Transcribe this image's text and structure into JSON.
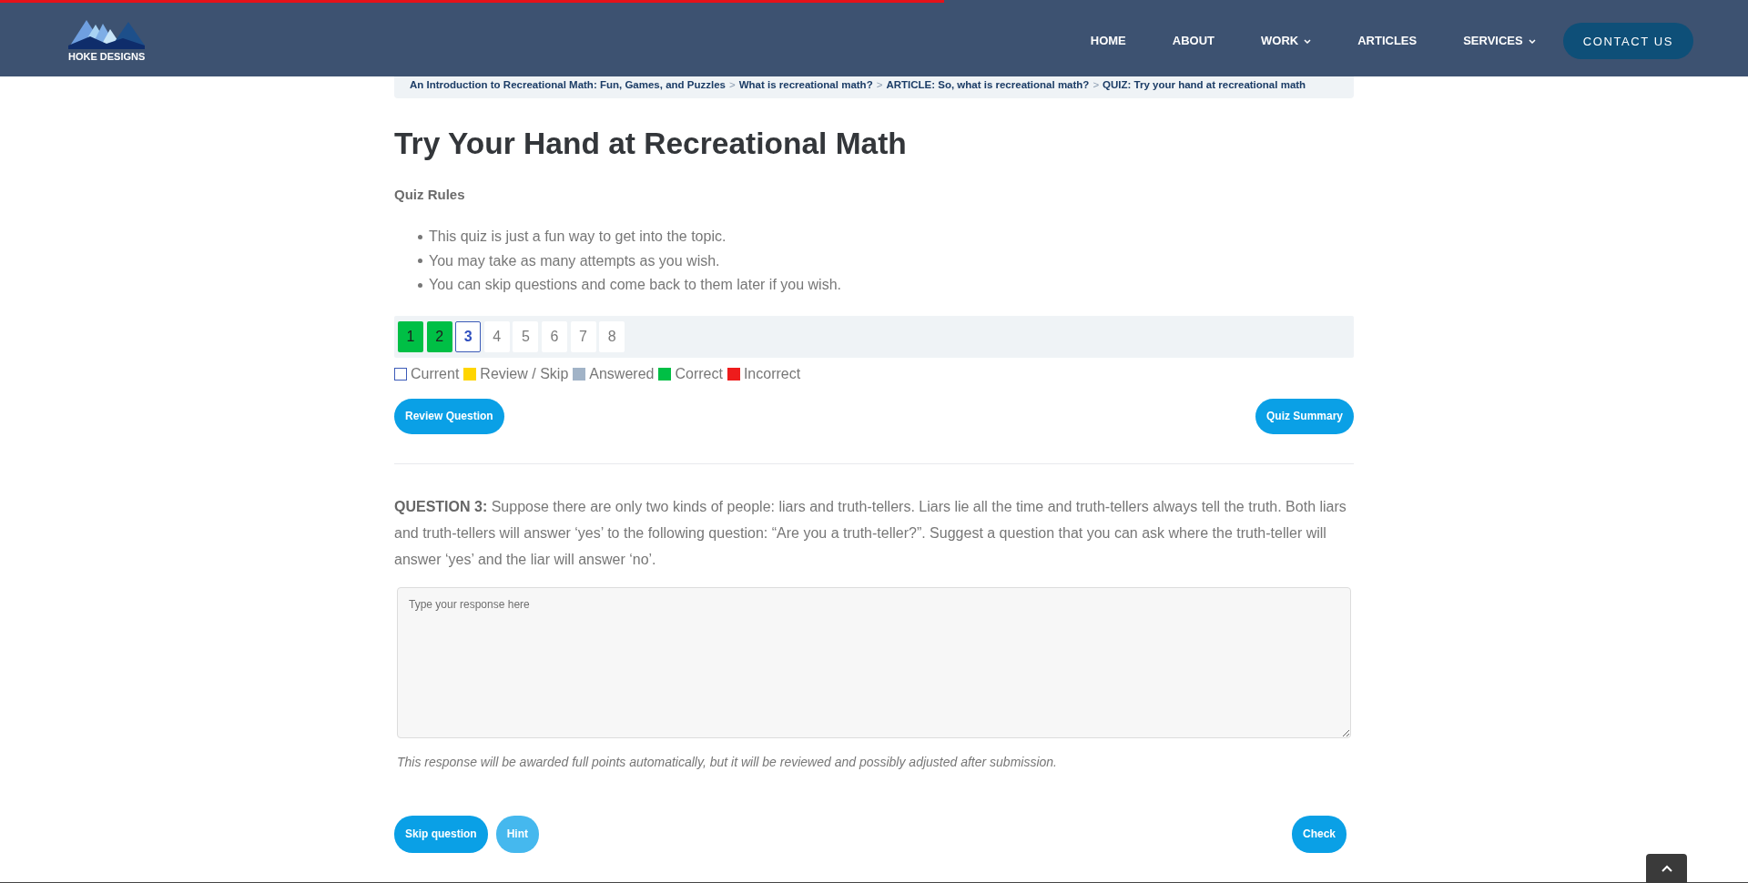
{
  "reading_progress": {
    "level": 0.54
  },
  "header": {
    "logo_text": "HOKE DESIGNS",
    "nav": [
      {
        "label": "HOME",
        "dropdown": false
      },
      {
        "label": "ABOUT",
        "dropdown": false
      },
      {
        "label": "WORK",
        "dropdown": true
      },
      {
        "label": "ARTICLES",
        "dropdown": false
      },
      {
        "label": "SERVICES",
        "dropdown": true
      }
    ],
    "contact_button": "CONTACT US"
  },
  "breadcrumb": [
    {
      "kind": "link",
      "text": "An Introduction to Recreational Math: Fun, Games, and Puzzles"
    },
    {
      "kind": "separator",
      "text": ">"
    },
    {
      "kind": "link",
      "text": "What is recreational math?"
    },
    {
      "kind": "separator",
      "text": ">"
    },
    {
      "kind": "link",
      "text": "ARTICLE: So, what is recreational math?"
    },
    {
      "kind": "separator",
      "text": ">"
    },
    {
      "kind": "link",
      "text": "QUIZ: Try your hand at recreational math"
    }
  ],
  "title": "Try Your Hand at Recreational Math",
  "rules": {
    "heading": "Quiz Rules",
    "items": [
      "This quiz is just a fun way to get into the topic.",
      "You may take as many attempts as you wish.",
      "You can skip questions and come back to them later if you wish."
    ]
  },
  "pagination": [
    {
      "label": "1",
      "correct": true,
      "selected": false
    },
    {
      "label": "2",
      "correct": true,
      "selected": false
    },
    {
      "label": "3",
      "correct": false,
      "selected": true
    },
    {
      "label": "4",
      "correct": false,
      "selected": false
    },
    {
      "label": "5",
      "correct": false,
      "selected": false
    },
    {
      "label": "6",
      "correct": false,
      "selected": false
    },
    {
      "label": "7",
      "correct": false,
      "selected": false
    },
    {
      "label": "8",
      "correct": false,
      "selected": false
    }
  ],
  "legend": [
    {
      "label": "Current",
      "kind": "outline",
      "color": "#3c5bb8"
    },
    {
      "label": "Review / Skip",
      "kind": "fill",
      "color": "#ffd500"
    },
    {
      "label": "Answered",
      "kind": "fill",
      "color": "#a1b3c7"
    },
    {
      "label": "Correct",
      "kind": "fill",
      "color": "#00bf45"
    },
    {
      "label": "Incorrect",
      "kind": "fill",
      "color": "#ee1c1c"
    }
  ],
  "review_button": {
    "label": "Review Question"
  },
  "summary_button": {
    "label": "Quiz Summary"
  },
  "question": {
    "text": "**QUESTION 3:** Suppose there are only two kinds of people: liars and truth-tellers. Liars lie all the time and truth-tellers always tell the truth. Both liars and truth-tellers will answer ‘yes’ to the following question: “Are you a truth-teller?”. Suggest a question that you can ask where the truth-teller will answer ‘yes’ and the liar will answer ‘no’.",
    "answer": {
      "placeholder": "Type your response here"
    },
    "note": "This response will be awarded full points automatically, but it will be reviewed and possibly adjusted after submission."
  },
  "question_actions": [
    {
      "label": "Skip question",
      "disabled": false
    },
    {
      "label": "Hint",
      "disabled": true
    }
  ],
  "check_button": {
    "label": "Check"
  }
}
